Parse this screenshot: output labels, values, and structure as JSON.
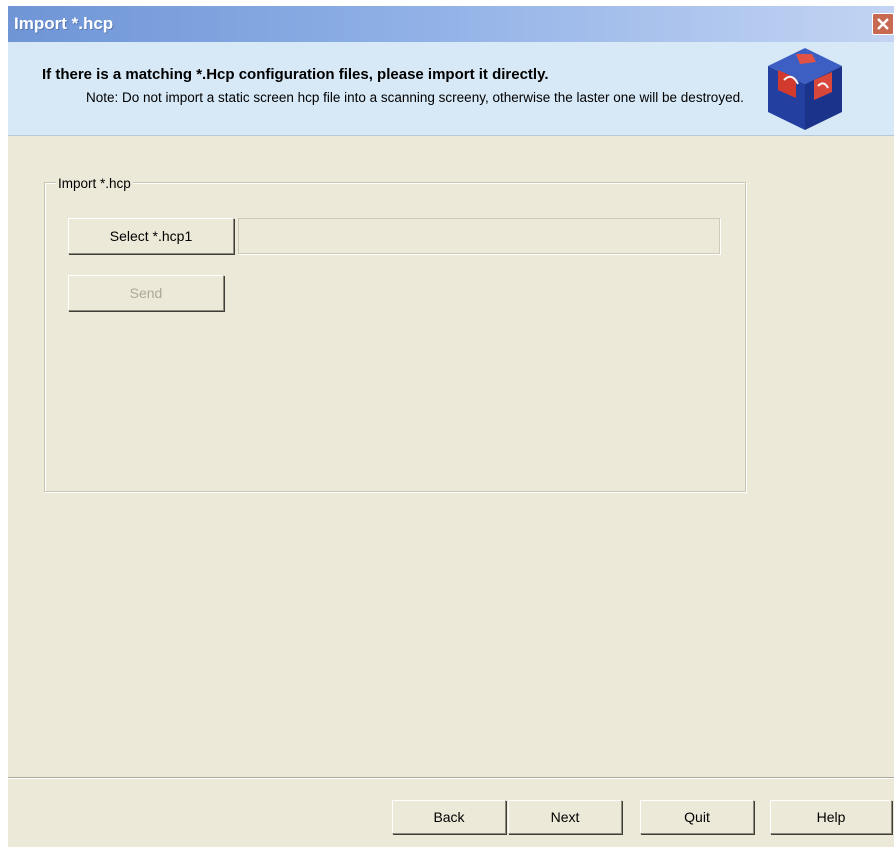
{
  "window": {
    "title": "Import *.hcp",
    "close_icon": "close-x-icon"
  },
  "header": {
    "title": "If there is a matching *.Hcp configuration files, please import it directly.",
    "note": "Note: Do not import a static screen hcp file into a scanning screeny, otherwise the laster one will be destroyed.",
    "logo_icon": "blue-cube-logo-icon"
  },
  "group": {
    "label": "Import *.hcp",
    "select_button_label": "Select *.hcp1",
    "path_value": "",
    "send_button_label": "Send"
  },
  "footer": {
    "back_label": "Back",
    "next_label": "Next",
    "quit_label": "Quit",
    "help_label": "Help"
  },
  "colors": {
    "dialog_background": "#ece9d8",
    "header_band": "#d7e9f7",
    "titlebar_start": "#6f95d6",
    "close_button": "#c86a52"
  }
}
